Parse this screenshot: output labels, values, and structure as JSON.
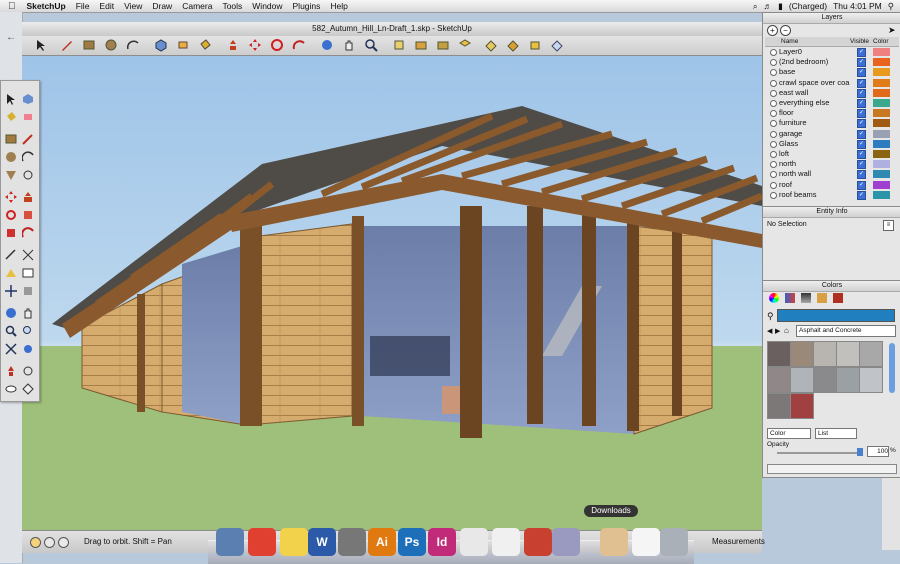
{
  "menubar": {
    "app": "SketchUp",
    "items": [
      "File",
      "Edit",
      "View",
      "Draw",
      "Camera",
      "Tools",
      "Window",
      "Plugins",
      "Help"
    ],
    "battery": "(Charged)",
    "clock": "Thu 4:01 PM"
  },
  "window": {
    "title": "582_Autumn_Hill_Ln-Draft_1.skp - SketchUp"
  },
  "status": {
    "hint": "Drag to orbit.  Shift = Pan",
    "measurements_label": "Measurements"
  },
  "layers": {
    "title": "Layers",
    "col_name": "Name",
    "col_visible": "Visible",
    "col_color": "Color",
    "rows": [
      {
        "name": "Layer0",
        "color": "#f08080"
      },
      {
        "name": "(2nd bedroom)",
        "color": "#e8641e"
      },
      {
        "name": "base",
        "color": "#e89a1e"
      },
      {
        "name": "crawl space over coa",
        "color": "#e07c18"
      },
      {
        "name": "east wall",
        "color": "#e06a1a"
      },
      {
        "name": "everything else",
        "color": "#3aa88c"
      },
      {
        "name": "floor",
        "color": "#c8781e"
      },
      {
        "name": "furniture",
        "color": "#a05a14"
      },
      {
        "name": "garage",
        "color": "#9aa0b4"
      },
      {
        "name": "Glass",
        "color": "#2e7cc0"
      },
      {
        "name": "loft",
        "color": "#8a6410"
      },
      {
        "name": "north",
        "color": "#b0b0e0"
      },
      {
        "name": "north wall",
        "color": "#2e8ab0"
      },
      {
        "name": "roof",
        "color": "#a040d0"
      },
      {
        "name": "roof beams",
        "color": "#2a94a8"
      }
    ]
  },
  "entity": {
    "title": "Entity Info",
    "selection": "No Selection"
  },
  "colors": {
    "title": "Colors",
    "library": "Asphalt and Concrete",
    "mode1": "Color",
    "mode2": "List",
    "opacity_label": "Opacity",
    "opacity_value": "100",
    "opacity_unit": "%",
    "current_color": "#1f7fbf"
  },
  "dock": {
    "tooltip": "Downloads",
    "apps": [
      {
        "label": "",
        "color": "#5a7fb0"
      },
      {
        "label": "",
        "color": "#e04030"
      },
      {
        "label": "",
        "color": "#f2d24a"
      },
      {
        "label": "W",
        "color": "#2a5aa8"
      },
      {
        "label": "",
        "color": "#777777"
      },
      {
        "label": "Ai",
        "color": "#e07a10"
      },
      {
        "label": "Ps",
        "color": "#1c6fb8"
      },
      {
        "label": "Id",
        "color": "#c02a78"
      },
      {
        "label": "",
        "color": "#e8e8e8"
      },
      {
        "label": "",
        "color": "#f0f0f0"
      },
      {
        "label": "",
        "color": "#c84030"
      },
      {
        "label": "",
        "color": "#9a9ac0"
      },
      {
        "label": "",
        "color": "#e0c090"
      },
      {
        "label": "",
        "color": "#f5f5f5"
      },
      {
        "label": "",
        "color": "#aab0b8"
      }
    ]
  }
}
